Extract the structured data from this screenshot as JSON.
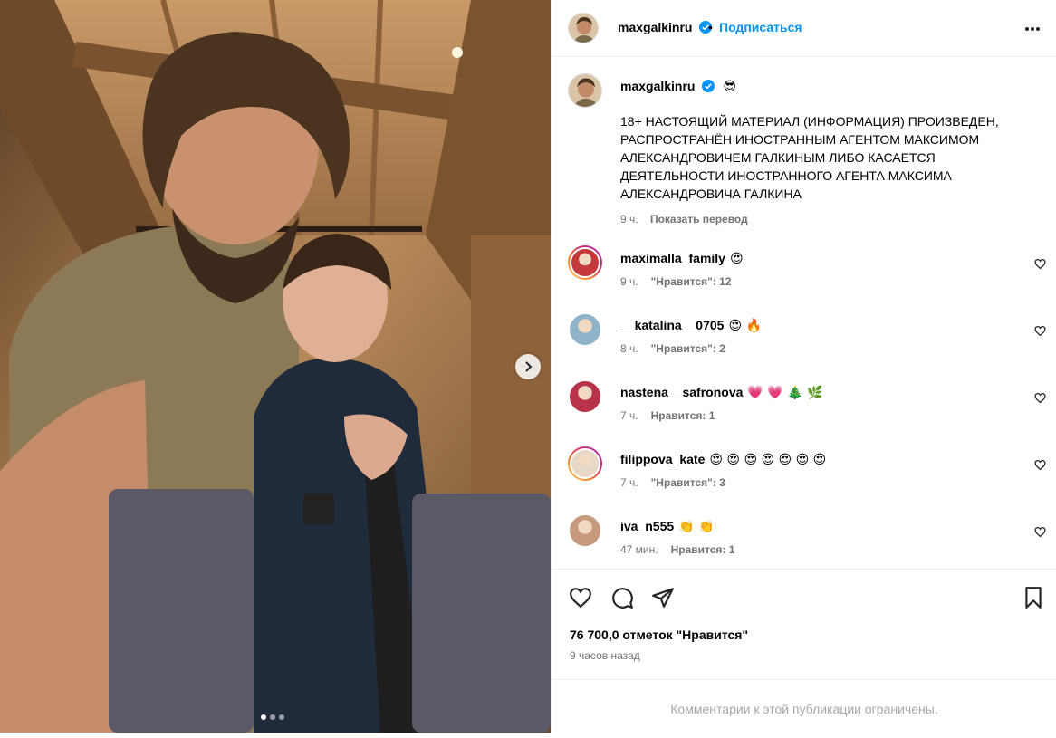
{
  "post": {
    "author": "maxgalkinru",
    "follow_label": "Подписаться",
    "separator": "•",
    "caption_emoji": "😎",
    "caption": "18+ НАСТОЯЩИЙ МАТЕРИАЛ (ИНФОРМАЦИЯ) ПРОИЗВЕДЕН, РАСПРОСТРАНЁН ИНОСТРАННЫМ АГЕНТОМ МАКСИМОМ АЛЕКСАНДРОВИЧЕМ ГАЛКИНЫМ ЛИБО КАСАЕТСЯ ДЕЯТЕЛЬНОСТИ ИНОСТРАННОГО АГЕНТА МАКСИМА АЛЕКСАНДРОВИЧА ГАЛКИНА",
    "caption_time": "9 ч.",
    "translate_label": "Показать перевод",
    "likes": "76 700,0 отметок \"Нравится\"",
    "posted": "9 часов назад",
    "comments_limited": "Комментарии к этой публикации ограничены."
  },
  "comments": [
    {
      "user": "maximalla_family",
      "emoji": "😍",
      "time": "9 ч.",
      "likes": "\"Нравится\": 12",
      "ring": true,
      "color": "#c43a3a"
    },
    {
      "user": "__katalina__0705",
      "emoji": "😍 🔥",
      "time": "8 ч.",
      "likes": "\"Нравится\": 2",
      "ring": false,
      "color": "#8fb3c9"
    },
    {
      "user": "nastena__safronova",
      "emoji": "💗 💗 🎄 🌿",
      "time": "7 ч.",
      "likes": "Нравится: 1",
      "ring": false,
      "color": "#b8324a"
    },
    {
      "user": "filippova_kate",
      "emoji": "😍 😍 😍 😍 😍 😍 😍",
      "time": "7 ч.",
      "likes": "\"Нравится\": 3",
      "ring": true,
      "color": "#e8d8c8"
    },
    {
      "user": "iva_n555",
      "emoji": "👏 👏",
      "time": "47 мин.",
      "likes": "Нравится: 1",
      "ring": false,
      "color": "#c79a7e"
    }
  ],
  "colors": {
    "accent": "#0095f6",
    "secondary_text": "#737373",
    "verified": "#0095f6"
  }
}
